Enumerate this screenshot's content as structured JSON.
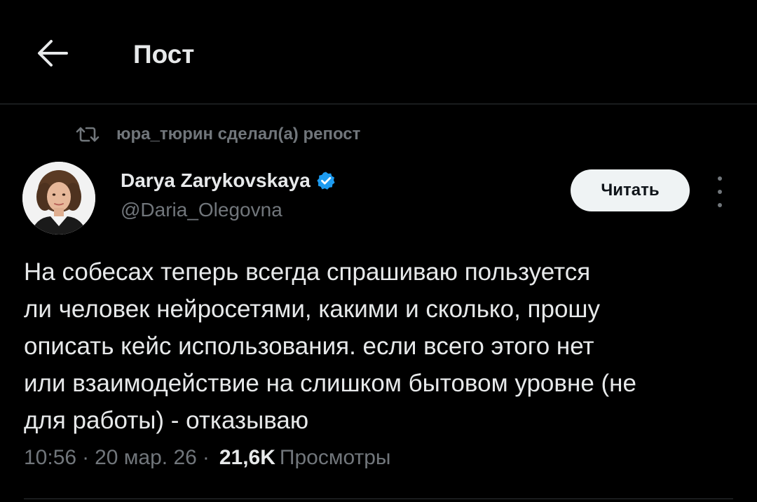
{
  "header": {
    "title": "Пост",
    "back_icon": "arrow-left-icon"
  },
  "repost": {
    "icon": "repost-icon",
    "text": "юра_тюрин сделал(а) репост"
  },
  "author": {
    "name": "Darya Zarykovskaya",
    "handle": "@Daria_Olegovna",
    "verified_color": "#1d9bf0",
    "avatar_icon": "avatar-photo"
  },
  "follow_button": {
    "label": "Читать"
  },
  "more_icon": "more-vertical-icon",
  "post": {
    "text": "На собесах теперь всегда спрашиваю пользуется\nли человек нейросетями, какими и сколько, прошу\nописать кейс использования. если всего этого нет\nили взаимодействие на слишком бытовом уровне (не\nдля работы) - отказываю"
  },
  "meta": {
    "time": "10:56",
    "sep1": "·",
    "date": "20 мар. 26",
    "sep2": "·",
    "views_count": "21,6K",
    "views_label": "Просмотры"
  },
  "colors": {
    "background": "#000000",
    "text": "#e7e9ea",
    "muted": "#71767b",
    "accent": "#1d9bf0",
    "divider": "#2f3336"
  }
}
